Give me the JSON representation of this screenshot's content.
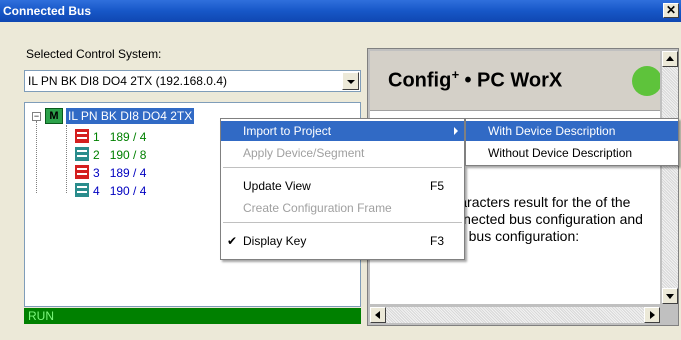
{
  "window": {
    "title": "Connected Bus",
    "close_glyph": "✕"
  },
  "selector": {
    "label": "Selected Control System:",
    "value": "IL PN BK DI8 DO4 2TX (192.168.0.4)"
  },
  "tree": {
    "root": {
      "icon_letter": "M",
      "label": "IL PN BK DI8 DO4 2TX"
    },
    "nodes": [
      {
        "num": "1",
        "value": "189 / 4",
        "color": "#008000",
        "icon": "red"
      },
      {
        "num": "2",
        "value": "190 / 8",
        "color": "#008000",
        "icon": "teal"
      },
      {
        "num": "3",
        "value": "189 / 4",
        "color": "#0000c0",
        "icon": "red"
      },
      {
        "num": "4",
        "value": "190 / 4",
        "color": "#0000c0",
        "icon": "teal"
      }
    ]
  },
  "status": {
    "text": "RUN"
  },
  "info": {
    "logo_main": "Config",
    "logo_sup": "+",
    "logo_rest": " • PC WorX",
    "text": "colors and characters result for the of the physically connected bus configuration and the configured bus configuration:"
  },
  "context_menu": {
    "items": [
      {
        "label": "Import to Project",
        "key": "",
        "state": "highlighted",
        "submenu": true
      },
      {
        "label": "Apply Device/Segment",
        "key": "",
        "state": "disabled"
      },
      {
        "label": "Update View",
        "key": "F5",
        "state": "normal"
      },
      {
        "label": "Create Configuration Frame",
        "key": "",
        "state": "disabled"
      },
      {
        "label": "Display Key",
        "key": "F3",
        "state": "checked"
      }
    ]
  },
  "submenu": {
    "items": [
      {
        "label": "With Device Description",
        "state": "highlighted"
      },
      {
        "label": "Without Device Description",
        "state": "normal"
      }
    ]
  }
}
